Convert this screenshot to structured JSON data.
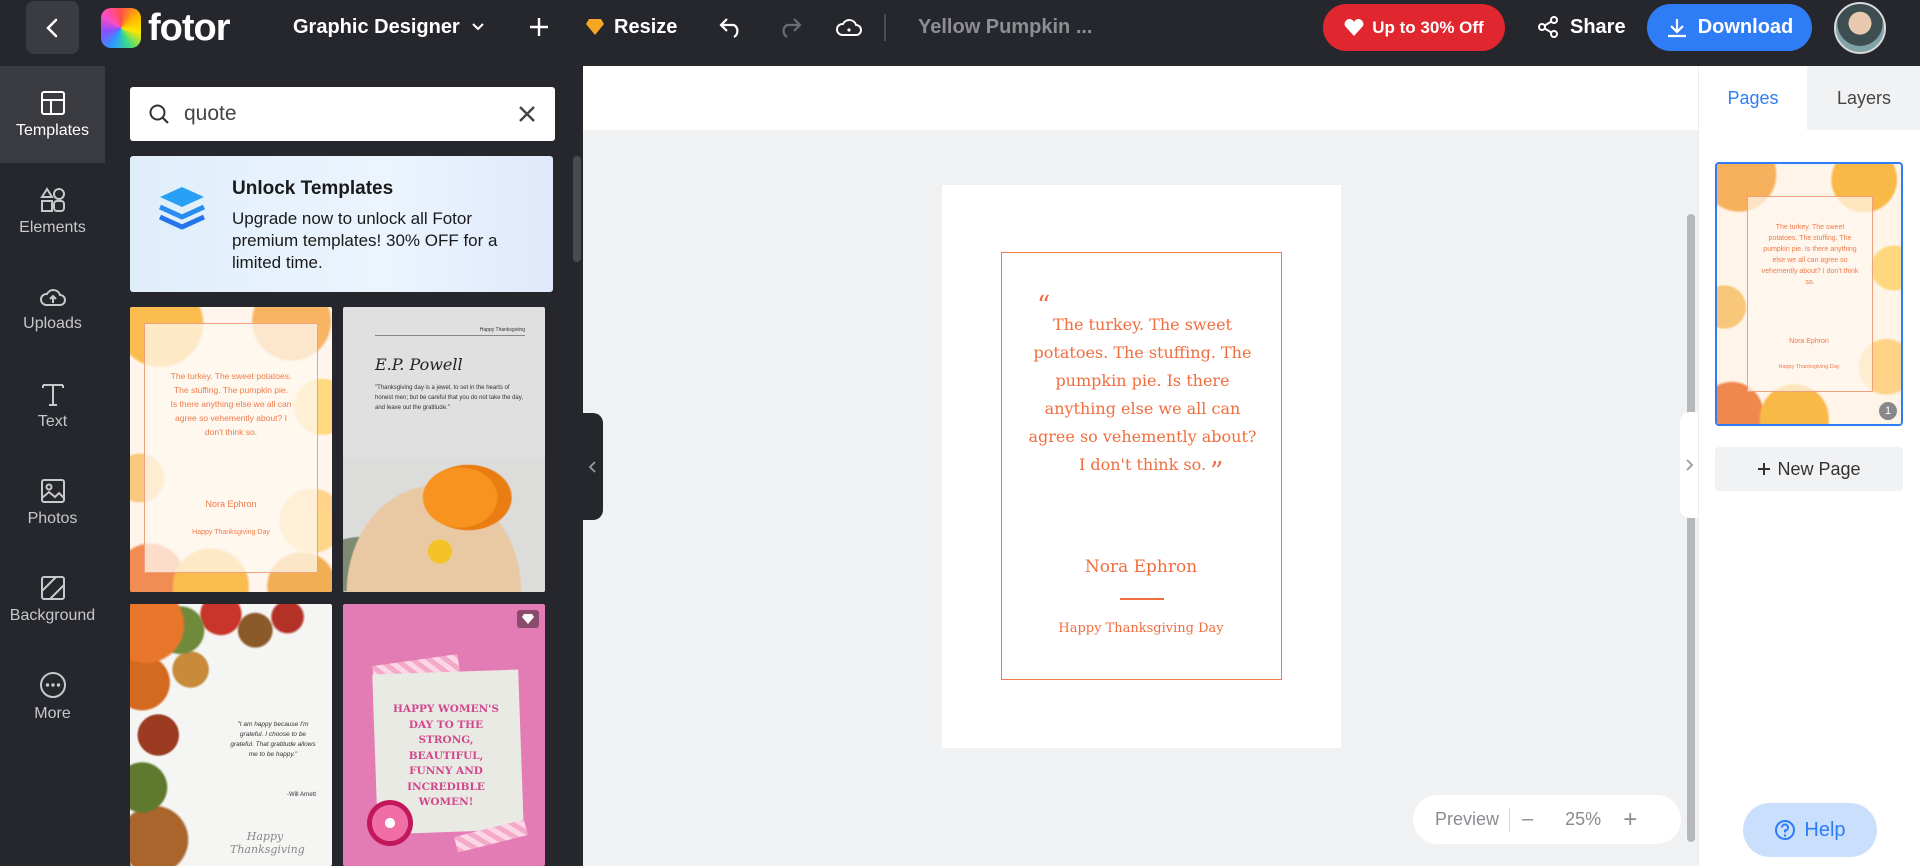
{
  "topbar": {
    "logo_text": "fotor",
    "mode_label": "Graphic Designer",
    "resize_label": "Resize",
    "doc_title": "Yellow Pumpkin ...",
    "promo_label": "Up to 30% Off",
    "share_label": "Share",
    "download_label": "Download"
  },
  "rail": {
    "items": [
      {
        "label": "Templates",
        "icon": "templates-icon"
      },
      {
        "label": "Elements",
        "icon": "elements-icon"
      },
      {
        "label": "Uploads",
        "icon": "upload-icon"
      },
      {
        "label": "Text",
        "icon": "text-icon"
      },
      {
        "label": "Photos",
        "icon": "photos-icon"
      },
      {
        "label": "Background",
        "icon": "background-icon"
      },
      {
        "label": "More",
        "icon": "more-icon"
      }
    ]
  },
  "panel": {
    "search_value": "quote",
    "unlock_title": "Unlock Templates",
    "unlock_desc": "Upgrade now to unlock all Fotor premium templates! 30% OFF for a limited time.",
    "cards": [
      {
        "quote": "The turkey. The sweet potatoes. The stuffing. The pumpkin pie. Is there anything else we all can agree so vehemently about? I don't think so.",
        "author": "Nora Ephron",
        "footer": "Happy Thanksgiving Day"
      },
      {
        "tag": "Happy Thanksgiving",
        "heading": "E.P. Powell",
        "quote": "\"Thanksgiving day is a jewel, to set in the hearts of honest men; but be careful that you do not take the day, and leave out the gratitude.\""
      },
      {
        "quote": "\"I am happy because I'm grateful. I choose to be grateful. That gratitude allows me to be happy.\"",
        "author": "-Will Arnett",
        "footer": "Happy Thanksgiving"
      },
      {
        "quote": "HAPPY WOMEN'S DAY TO THE STRONG, BEAUTIFUL, FUNNY AND INCREDIBLE WOMEN!"
      }
    ]
  },
  "canvas": {
    "quote": "The turkey. The sweet potatoes. The stuffing. The pumpkin pie. Is there anything else we all can agree so vehemently about? I don't think so.",
    "open_quote": "“",
    "close_quote": "”",
    "author": "Nora Ephron",
    "footer": "Happy Thanksgiving Day",
    "zoom": {
      "preview_label": "Preview",
      "minus": "–",
      "value": "25%",
      "plus": "+"
    }
  },
  "right": {
    "tabs": [
      {
        "label": "Pages",
        "active": true
      },
      {
        "label": "Layers",
        "active": false
      }
    ],
    "page_number": "1",
    "new_page_label": "New Page",
    "help_label": "Help"
  },
  "colors": {
    "accent": "#2f7df6",
    "promo": "#e0262f",
    "quote": "#f26d3d",
    "dark": "#26272c"
  }
}
